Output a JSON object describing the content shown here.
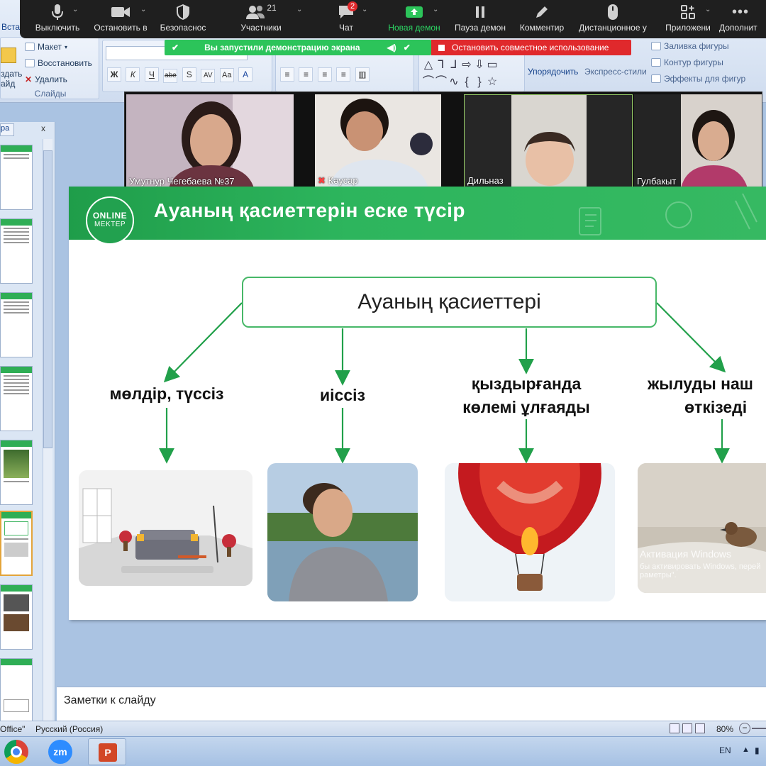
{
  "ribbon": {
    "tab_insert": "Вста",
    "slides": {
      "create_top": "здать",
      "create_bottom": "айд",
      "layout": "Макет",
      "reset": "Восстановить",
      "delete": "Удалить",
      "group": "Слайды"
    },
    "font_buttons": [
      "Ж",
      "К",
      "Ч",
      "abe",
      "S",
      "AV",
      "Aa",
      "A"
    ],
    "arrange": "Упорядочить",
    "quick_styles": "Экспресс-стили",
    "shape_fill": "Заливка фигуры",
    "shape_outline": "Контур фигуры",
    "shape_effects": "Эффекты для фигур"
  },
  "zoom": {
    "buttons": [
      {
        "label": "Выключить",
        "icon": "microphone-icon"
      },
      {
        "label": "Остановить в",
        "icon": "video-camera-icon"
      },
      {
        "label": "Безопаснос",
        "icon": "shield-icon"
      },
      {
        "label": "Участники",
        "icon": "participants-icon",
        "count": "21"
      },
      {
        "label": "Чат",
        "icon": "chat-icon",
        "badge": "2"
      },
      {
        "label": "Новая демон",
        "icon": "share-screen-icon"
      },
      {
        "label": "Пауза демон",
        "icon": "pause-icon"
      },
      {
        "label": "Комментир",
        "icon": "pencil-icon"
      },
      {
        "label": "Дистанционное у",
        "icon": "mouse-icon"
      },
      {
        "label": "Приложени",
        "icon": "apps-icon"
      },
      {
        "label": "Дополнит",
        "icon": "more-icon"
      }
    ],
    "share_banner": "Вы запустили демонстрацию экрана",
    "stop_share": "Остановить совместное использование"
  },
  "videos": [
    {
      "name": "Умутнур Чегебаева №37"
    },
    {
      "name": "Кәусар"
    },
    {
      "name": "Дильназ"
    },
    {
      "name": "Гулбакыт"
    }
  ],
  "left_pane": {
    "tab": "ра",
    "close": "x"
  },
  "slide": {
    "title": "Ауаның  қасиеттерін еске түсір",
    "logo_top": "ONLINE",
    "logo_bottom": "MEKTEP",
    "center": "Ауаның  қасиеттері",
    "props": [
      {
        "line1": "мөлдір, түссіз",
        "line2": ""
      },
      {
        "line1": "иіссіз",
        "line2": ""
      },
      {
        "line1": "қыздырғанда",
        "line2": "көлемі ұлғаяды"
      },
      {
        "line1": "жылуды наш",
        "line2": "өткізеді"
      }
    ],
    "activation_title": "Активация Windows",
    "activation_sub": "бы активировать Windows, перей",
    "activation_sub2": "раметры\"."
  },
  "notes": {
    "placeholder": "Заметки к слайду"
  },
  "status": {
    "office": "Office\"",
    "language": "Русский (Россия)",
    "zoom": "80%"
  },
  "taskbar": {
    "zoom_app": "zm",
    "lang": "EN"
  }
}
